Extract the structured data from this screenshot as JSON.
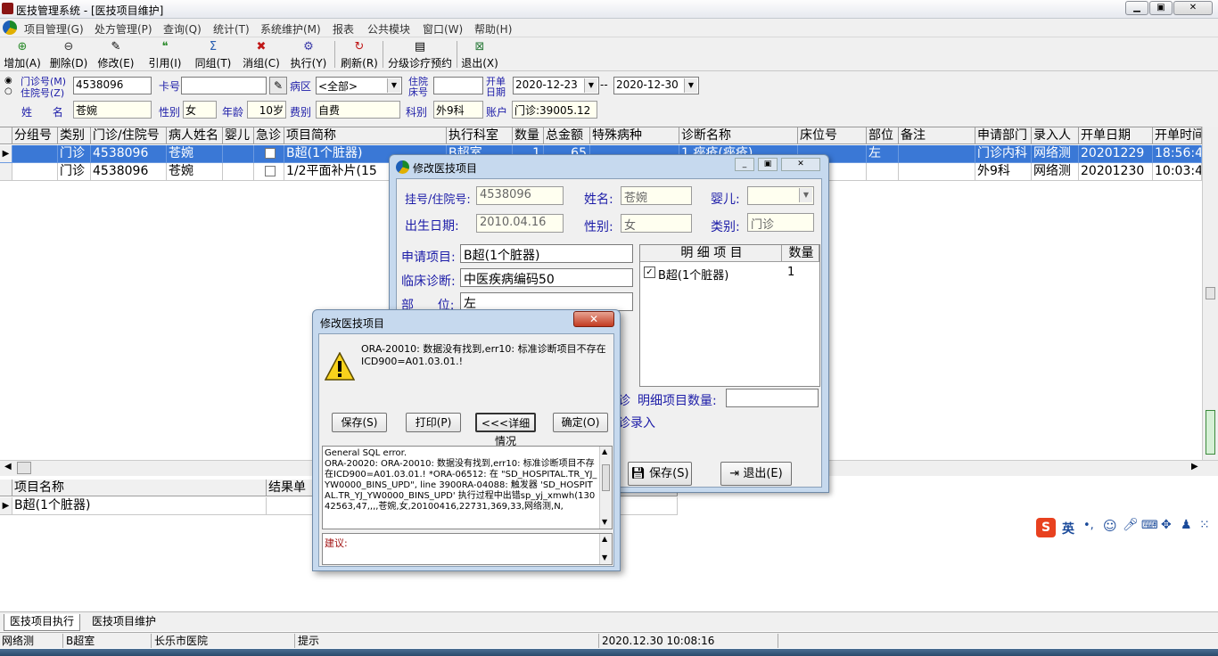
{
  "window": {
    "title": "医技管理系统 - [医技项目维护]"
  },
  "menu": [
    "项目管理(G)",
    "处方管理(P)",
    "查询(Q)",
    "统计(T)",
    "系统维护(M)",
    "报表",
    "公共模块",
    "窗口(W)",
    "帮助(H)"
  ],
  "toolbar": [
    "增加(A)",
    "删除(D)",
    "修改(E)",
    "引用(I)",
    "同组(T)",
    "消组(C)",
    "执行(Y)",
    "刷新(R)",
    "分级诊疗预约",
    "退出(X)"
  ],
  "form": {
    "radio_outpatient": "门诊号(M)",
    "radio_inpatient": "住院号(Z)",
    "patient_no": "4538096",
    "card_label": "卡号",
    "card_value": "",
    "ward_label": "病区",
    "ward_value": "<全部>",
    "inpatient_label_1": "住院",
    "inpatient_label_2": "床号",
    "bed_value": "",
    "order_date_label_1": "开单",
    "order_date_label_2": "日期",
    "date_from": "2020-12-23",
    "date_sep": "--",
    "date_to": "2020-12-30",
    "name_label": "姓      名",
    "name_value": "苍婉",
    "sex_label": "性别",
    "sex_value": "女",
    "age_label": "年龄",
    "age_value": "10岁",
    "fee_label": "费别",
    "fee_value": "自费",
    "dept_label": "科别",
    "dept_value": "外9科",
    "account_label": "账户",
    "account_value": "门诊:39005.12"
  },
  "grid": {
    "headers": [
      "分组号",
      "类别",
      "门诊/住院号",
      "病人姓名",
      "婴儿",
      "急诊",
      "项目简称",
      "执行科室",
      "数量",
      "总金额",
      "特殊病种",
      "诊断名称",
      "床位号",
      "部位",
      "备注",
      "申请部门",
      "录入人",
      "开单日期",
      "开单时间"
    ],
    "rows": [
      [
        "",
        "门诊",
        "4538096",
        "苍婉",
        "",
        "",
        "B超(1个脏器)",
        "B超室",
        "1",
        "65",
        "",
        "1.痤疮(痤疮)",
        "",
        "左",
        "",
        "门诊内科",
        "网络测",
        "20201229",
        "18:56:4"
      ],
      [
        "",
        "门诊",
        "4538096",
        "苍婉",
        "",
        "",
        "1/2平面补片(15",
        "",
        "",
        "",
        "",
        "",
        "",
        "",
        "",
        "外9科",
        "网络测",
        "20201230",
        "10:03:4"
      ]
    ]
  },
  "grid2": {
    "headers": [
      "项目名称",
      "结果单"
    ],
    "rows": [
      [
        "B超(1个脏器)",
        ""
      ]
    ]
  },
  "bottom_tabs": [
    "医技项目执行",
    "医技项目维护"
  ],
  "status": {
    "user": "网络测",
    "room": "B超室",
    "hospital": "长乐市医院",
    "hint": "提示",
    "datetime": "2020.12.30 10:08:16"
  },
  "dialog_edit": {
    "title": "修改医技项目",
    "reg_label": "挂号/住院号:",
    "reg_value": "4538096",
    "name_label": "姓名:",
    "name_value": "苍婉",
    "baby_label": "婴儿:",
    "birth_label": "出生日期:",
    "birth_value": "2010.04.16",
    "sex_label": "性别:",
    "sex_value": "女",
    "type_label": "类别:",
    "type_value": "门诊",
    "apply_label": "申请项目:",
    "apply_value": "B超(1个脏器)",
    "diag_label": "临床诊断:",
    "diag_value": "中医疾病编码50",
    "part_label": "部      位:",
    "part_value": "左",
    "detail_header_item": "明  细  项  目",
    "detail_header_qty": "数量",
    "detail_items": [
      {
        "name": "B超(1个脏器)",
        "qty": "1"
      }
    ],
    "partial_text_1": "诊",
    "detail_count_label": "明细项目数量:",
    "partial_text_2": "诊录入",
    "save_button": "保存(S)",
    "exit_button": "退出(E)"
  },
  "dialog_error": {
    "title": "修改医技项目",
    "message": "ORA-20010: 数据没有找到,err10: 标准诊断项目不存在ICD900=A01.03.01.!",
    "buttons": [
      "保存(S)",
      "打印(P)",
      "<<<详细情况",
      "确定(O)"
    ],
    "detail_text": "General SQL error.\nORA-20020: ORA-20010: 数据没有找到,err10: 标准诊断项目不存在ICD900=A01.03.01.! *ORA-06512: 在 \"SD_HOSPITAL.TR_YJ_YW0000_BINS_UPD\", line 3900RA-04088: 触发器 'SD_HOSPITAL.TR_YJ_YW0000_BINS_UPD' 执行过程中出错sp_yj_xmwh(13042563,47,,,,苍婉,女,20100416,22731,369,33,网络测,N,",
    "suggest_label": "建议:"
  },
  "ime": {
    "mode": "英"
  },
  "colors": {
    "selection": "#3a78d6",
    "label_blue": "#1c1ca8",
    "dialog_frame": "#c6d9ee"
  }
}
